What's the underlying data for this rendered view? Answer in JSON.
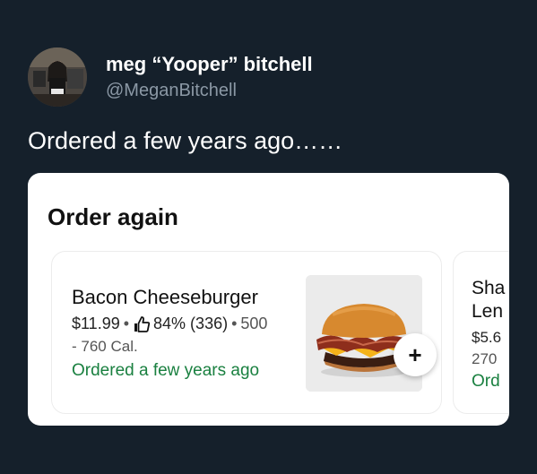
{
  "tweet": {
    "display_name": "meg “Yooper” bitchell",
    "handle": "@MeganBitchell",
    "text": "Ordered a few years ago……",
    "avatar_icon": "profile-photo-icon"
  },
  "card": {
    "title": "Order again",
    "items": [
      {
        "name": "Bacon Cheeseburger",
        "price": "$11.99",
        "dot": "•",
        "rating": "84% (336)",
        "calories_start": "500",
        "calories_end": "- 760 Cal.",
        "ordered_label": "Ordered a few years ago",
        "add_label": "+",
        "icons": [
          "thumbs-up-icon",
          "burger-image",
          "plus-icon"
        ]
      },
      {
        "name_line1": "Sha",
        "name_line2": "Len",
        "price": "$5.6",
        "calories": "270",
        "ordered_label": "Ord"
      }
    ]
  },
  "colors": {
    "background": "#15202b",
    "ordered_green": "#1a8040",
    "handle_gray": "#8b98a5"
  }
}
